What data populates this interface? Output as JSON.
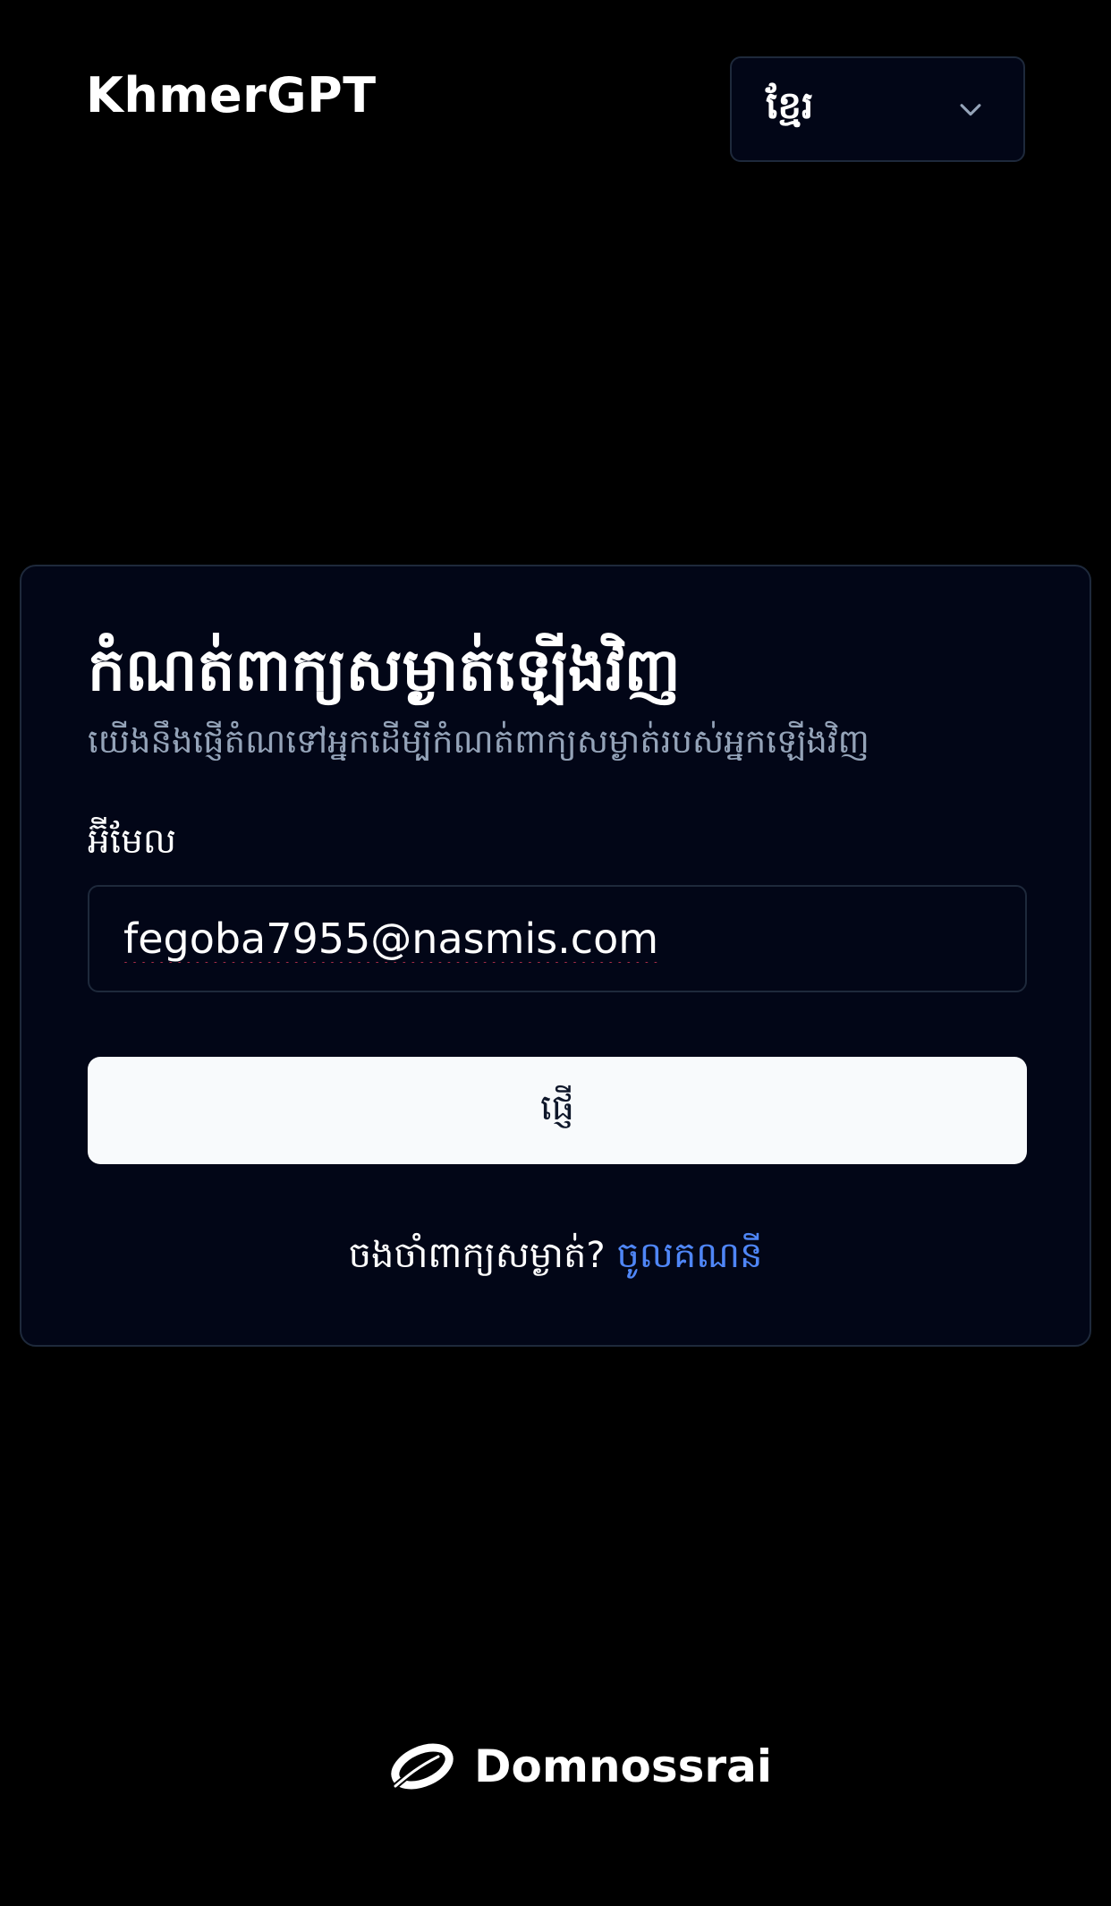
{
  "header": {
    "brand": "KhmerGPT",
    "language_select": {
      "value": "ខ្មែរ",
      "icon": "chevron-down-icon"
    }
  },
  "card": {
    "title": "កំណត់ពាក្យសម្ងាត់ឡើងវិញ",
    "subtitle": "យើងនឹងផ្ញើតំណទៅអ្នកដើម្បីកំណត់ពាក្យសម្ងាត់របស់អ្នកឡើងវិញ",
    "email_label": "អ៊ីមែល",
    "email_value": "fegoba7955@nasmis.com",
    "submit_label": "ផ្ញើ",
    "remember_text": "ចងចាំពាក្យសម្ងាត់?",
    "login_link": "ចូលគណនី"
  },
  "footer": {
    "logo_text": "Domnossrai",
    "logo_icon": "domnossrai-logo-icon"
  },
  "colors": {
    "background": "#000000",
    "card_background": "#020617",
    "border": "#1e293b",
    "muted_text": "#94a3b8",
    "link": "#4f86f7",
    "button_bg": "#f8fafc",
    "button_text": "#0f172a"
  }
}
